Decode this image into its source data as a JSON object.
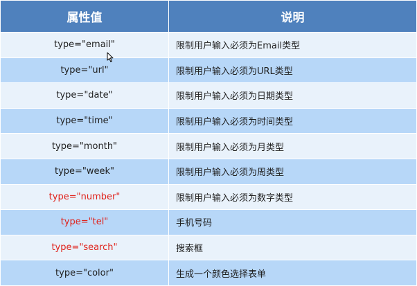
{
  "table": {
    "headers": {
      "attr": "属性值",
      "desc": "说明"
    },
    "rows": [
      {
        "attr": "type=\"email\"",
        "desc": "限制用户输入必须为Email类型",
        "highlight": false
      },
      {
        "attr": "type=\"url\"",
        "desc": "限制用户输入必须为URL类型",
        "highlight": false
      },
      {
        "attr": "type=\"date\"",
        "desc": "限制用户输入必须为日期类型",
        "highlight": false
      },
      {
        "attr": "type=\"time\"",
        "desc": "限制用户输入必须为时间类型",
        "highlight": false
      },
      {
        "attr": "type=\"month\"",
        "desc": "限制用户输入必须为月类型",
        "highlight": false
      },
      {
        "attr": "type=\"week\"",
        "desc": "限制用户输入必须为周类型",
        "highlight": false
      },
      {
        "attr": "type=\"number\"",
        "desc": "限制用户输入必须为数字类型",
        "highlight": true
      },
      {
        "attr": "type=\"tel\"",
        "desc": "手机号码",
        "highlight": true
      },
      {
        "attr": "type=\"search\"",
        "desc": "搜索框",
        "highlight": true
      },
      {
        "attr": "type=\"color\"",
        "desc": "生成一个颜色选择表单",
        "highlight": false
      }
    ]
  },
  "colors": {
    "header_bg": "#4f81bd",
    "row_light": "#e9f2fb",
    "row_dark": "#b7d7f8",
    "highlight_text": "#e0221b"
  },
  "cursor": {
    "icon": "mouse-pointer-icon"
  }
}
